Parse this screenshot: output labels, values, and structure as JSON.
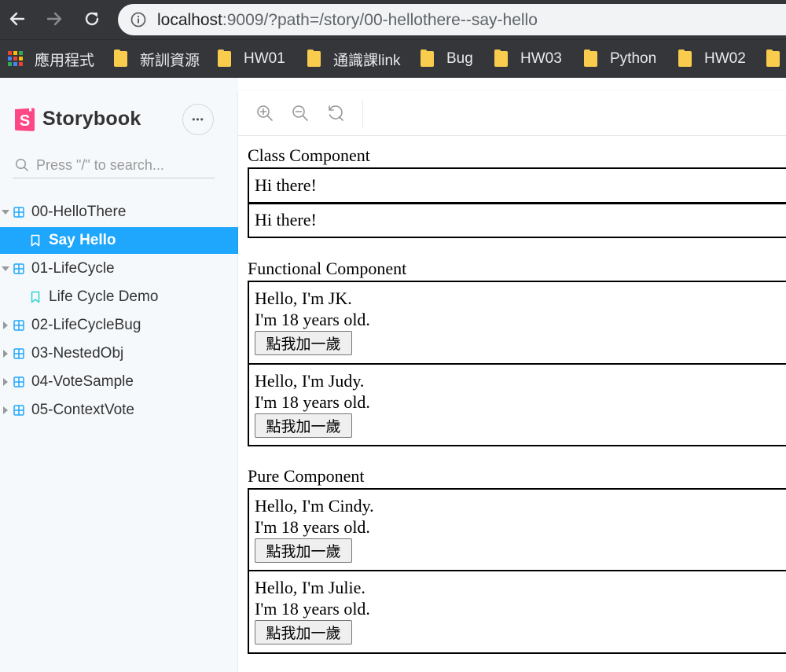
{
  "browser": {
    "url_host": "localhost",
    "url_path": ":9009/?path=/story/00-hellothere--say-hello",
    "bookmarks": [
      "應用程式",
      "新訓資源",
      "HW01",
      "通識課link",
      "Bug",
      "HW03",
      "Python",
      "HW02"
    ]
  },
  "sidebar": {
    "brand": "Storybook",
    "more_label": "•••",
    "search_placeholder": "Press \"/\" to search...",
    "tree": [
      {
        "type": "component",
        "label": "00-HelloThere",
        "expanded": true
      },
      {
        "type": "story",
        "label": "Say Hello",
        "selected": true
      },
      {
        "type": "component",
        "label": "01-LifeCycle",
        "expanded": true
      },
      {
        "type": "story",
        "label": "Life Cycle Demo",
        "selected": false
      },
      {
        "type": "component",
        "label": "02-LifeCycleBug",
        "expanded": false
      },
      {
        "type": "component",
        "label": "03-NestedObj",
        "expanded": false
      },
      {
        "type": "component",
        "label": "04-VoteSample",
        "expanded": false
      },
      {
        "type": "component",
        "label": "05-ContextVote",
        "expanded": false
      }
    ]
  },
  "toolbar": {
    "icons": [
      "zoom-in-icon",
      "zoom-out-icon",
      "reset-zoom-icon"
    ]
  },
  "story": {
    "class_section": {
      "title": "Class Component",
      "boxes": [
        "Hi there!",
        "Hi there!"
      ]
    },
    "functional_section": {
      "title": "Functional Component",
      "people": [
        {
          "greeting": "Hello, I'm JK.",
          "age_text": "I'm 18 years old.",
          "button": "點我加一歲"
        },
        {
          "greeting": "Hello, I'm Judy.",
          "age_text": "I'm 18 years old.",
          "button": "點我加一歲"
        }
      ]
    },
    "pure_section": {
      "title": "Pure Component",
      "people": [
        {
          "greeting": "Hello, I'm Cindy.",
          "age_text": "I'm 18 years old.",
          "button": "點我加一歲"
        },
        {
          "greeting": "Hello, I'm Julie.",
          "age_text": "I'm 18 years old.",
          "button": "點我加一歲"
        }
      ]
    }
  },
  "colors": {
    "accent": "#1ea7fd",
    "storybook_pink": "#ff4785",
    "chrome_dark": "#35363a",
    "folder": "#f9cc4e"
  }
}
